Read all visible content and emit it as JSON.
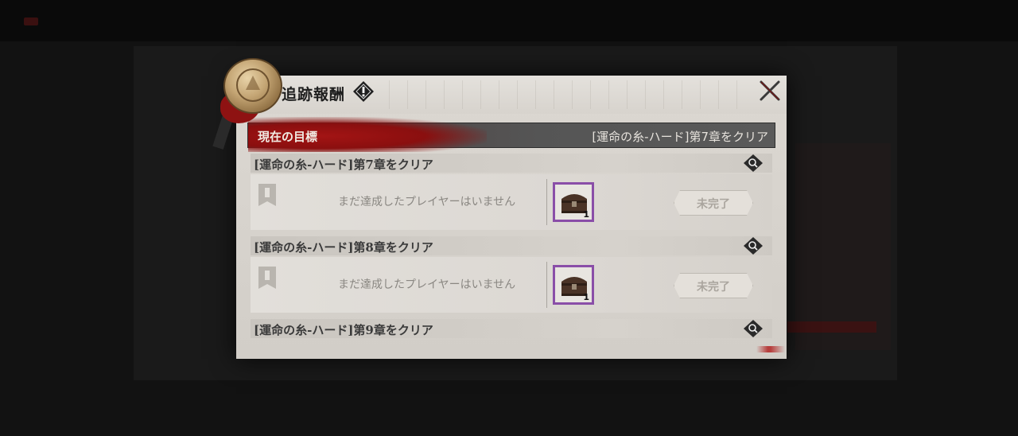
{
  "modal": {
    "title": "追跡報酬",
    "objective_label": "現在の目標",
    "objective_value": "[運命の糸-ハード]第7章をクリア"
  },
  "entries": [
    {
      "title": "[運命の糸-ハード]第7章をクリア",
      "no_player_text": "まだ達成したプレイヤーはいません",
      "reward_count": "1",
      "status_label": "未完了"
    },
    {
      "title": "[運命の糸-ハード]第8章をクリア",
      "no_player_text": "まだ達成したプレイヤーはいません",
      "reward_count": "1",
      "status_label": "未完了"
    },
    {
      "title": "[運命の糸-ハード]第9章をクリア"
    }
  ],
  "colors": {
    "accent_red": "#8e1212",
    "reward_frame": "#8a4ea8"
  },
  "icons": [
    "seal-icon",
    "info-icon",
    "close-icon",
    "magnifier-icon",
    "rank-banner-icon",
    "treasure-chest-icon"
  ]
}
